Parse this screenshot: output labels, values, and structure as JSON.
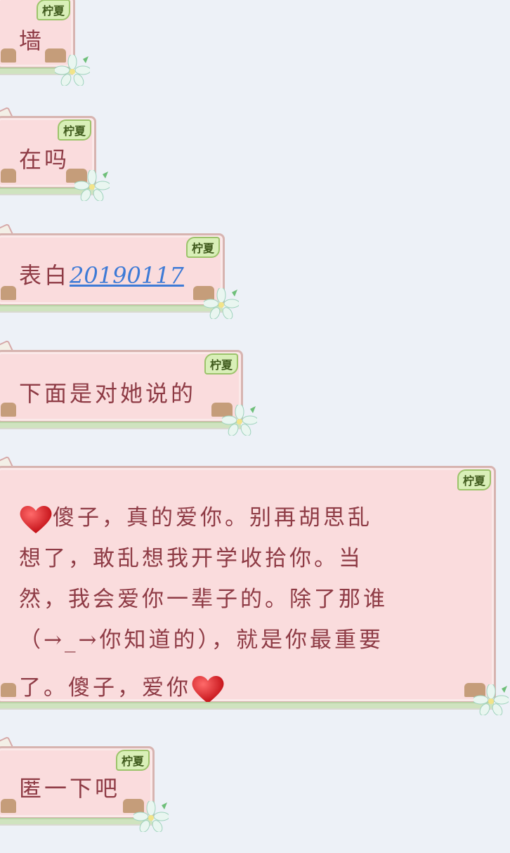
{
  "sender_tag": "柠夏",
  "colors": {
    "background": "#edf1f7",
    "bubble": "#fadcdd",
    "text": "#8e3b45",
    "link": "#3d7ad6",
    "tag": "#d9efb8"
  },
  "messages": [
    {
      "text": "墙"
    },
    {
      "text": "在吗"
    },
    {
      "text": "表白",
      "link": "20190117"
    },
    {
      "text": "下面是对她说的"
    },
    {
      "lines": [
        "傻子，真的爱你。别再胡思乱",
        "想了，敢乱想我开学收拾你。当",
        "然，我会爱你一辈子的。除了那谁",
        "（→_→你知道的），就是你最重要",
        "了。傻子，爱你"
      ],
      "icons": [
        "heart-emoji",
        "heart-emoji"
      ]
    },
    {
      "text": "匿一下吧"
    }
  ]
}
